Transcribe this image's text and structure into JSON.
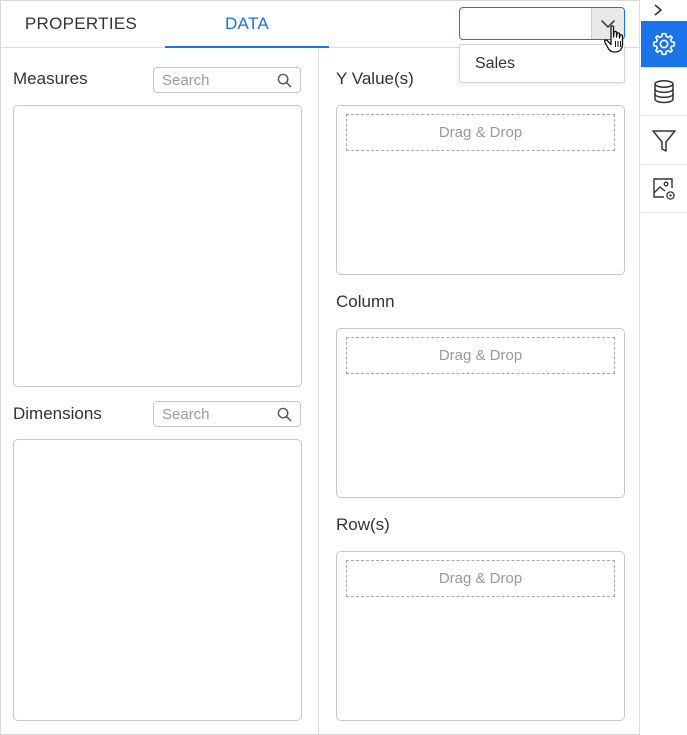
{
  "tabs": {
    "properties": "PROPERTIES",
    "data": "DATA"
  },
  "dropdown": {
    "value": "",
    "options": [
      "Sales"
    ]
  },
  "left": {
    "measures": {
      "title": "Measures",
      "search_placeholder": "Search"
    },
    "dimensions": {
      "title": "Dimensions",
      "search_placeholder": "Search"
    }
  },
  "right": {
    "y_values": {
      "title": "Y Value(s)",
      "drop_hint": "Drag & Drop"
    },
    "column": {
      "title": "Column",
      "drop_hint": "Drag & Drop"
    },
    "rows": {
      "title": "Row(s)",
      "drop_hint": "Drag & Drop"
    }
  },
  "iconbar": {
    "collapse_icon": "chevron-right-icon",
    "items": [
      {
        "icon": "gear-icon",
        "active": true
      },
      {
        "icon": "database-icon",
        "active": false
      },
      {
        "icon": "filter-icon",
        "active": false
      },
      {
        "icon": "image-settings-icon",
        "active": false
      }
    ]
  },
  "colors": {
    "accent": "#1a73e8",
    "border": "#c8c8c8",
    "text": "#333333",
    "muted": "#9a9a9a"
  }
}
